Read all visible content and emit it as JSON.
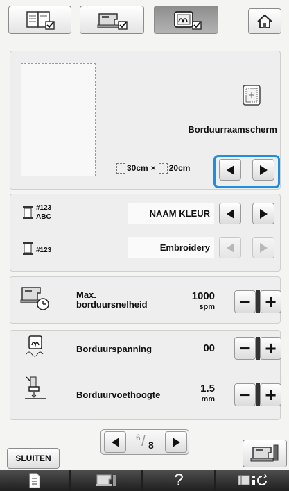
{
  "top_tabs": [
    {
      "name": "pattern-settings-tab",
      "icon": "book-checklist-icon"
    },
    {
      "name": "machine-settings-tab",
      "icon": "sewing-machine-icon"
    },
    {
      "name": "embroidery-settings-tab",
      "icon": "embroidery-frame-icon",
      "active": true
    }
  ],
  "home_icon": "home-icon",
  "frame": {
    "label": "Borduurraamscherm",
    "width_value": "30cm",
    "separator": "×",
    "height_value": "20cm"
  },
  "thread_display": {
    "value": "NAAM KLEUR",
    "icon_code": "#123",
    "icon_sub": "ABC"
  },
  "thread_brand": {
    "value": "Embroidery",
    "icon_code": "#123"
  },
  "max_speed": {
    "label_line1": "Max.",
    "label_line2": "borduursnelheid",
    "value": "1000",
    "unit": "spm"
  },
  "tension": {
    "label": "Borduurspanning",
    "value": "00"
  },
  "foot_height": {
    "label": "Borduurvoethoogte",
    "value": "1.5",
    "unit": "mm"
  },
  "pager": {
    "current": "6",
    "total": "8"
  },
  "close_button": "SLUITEN",
  "plus": "+",
  "minus": "−",
  "bottom_bar": [
    "document-icon",
    "sewing-machine-icon",
    "help-icon",
    "settings-icon"
  ],
  "help_label": "?",
  "highlight_color": "#1e8fe0"
}
